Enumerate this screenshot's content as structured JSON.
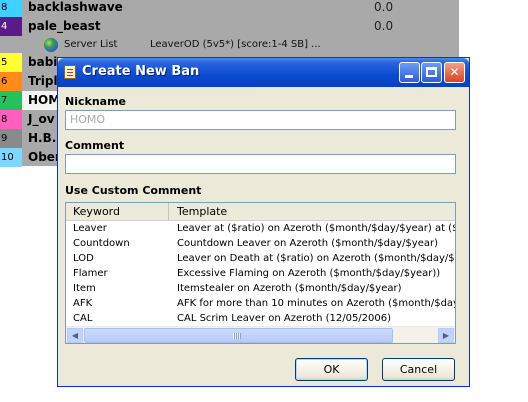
{
  "background": {
    "rows": [
      {
        "num": "8",
        "name": "backlashwave",
        "score": "0.0",
        "color": "#3fd0ff"
      },
      {
        "num": "4",
        "name": "pale_beast",
        "score": "0.0",
        "color": "#5a1a8a"
      },
      {
        "num": "5",
        "name": "babi",
        "score": "",
        "color": "#ffff33"
      },
      {
        "num": "6",
        "name": "Tripl",
        "score": "",
        "color": "#ff8c1a"
      },
      {
        "num": "7",
        "name": "HOM",
        "score": "",
        "color": "#22c45a"
      },
      {
        "num": "8",
        "name": "J_ov",
        "score": "",
        "color": "#ff5fbf"
      },
      {
        "num": "9",
        "name": "H.B.K",
        "score": "",
        "color": "#8a8a8a"
      },
      {
        "num": "10",
        "name": "Ober",
        "score": "",
        "color": "#7fd6ff"
      }
    ],
    "server_row": {
      "icon": "globe-icon",
      "label": "Server List",
      "detail": "LeaverOD (5v5*) [score:1-4 SB] ..."
    }
  },
  "dialog": {
    "title": "Create New Ban",
    "nickname_label": "Nickname",
    "nickname_value": "HOMO",
    "comment_label": "Comment",
    "comment_value": "",
    "custom_label": "Use Custom Comment",
    "columns": {
      "keyword": "Keyword",
      "template": "Template"
    },
    "rows": [
      {
        "keyword": "Leaver",
        "template": "Leaver at ($ratio) on Azeroth ($month/$day/$year) at ($"
      },
      {
        "keyword": "Countdown",
        "template": "Countdown Leaver on Azeroth ($month/$day/$year)"
      },
      {
        "keyword": "LOD",
        "template": "Leaver on Death at ($ratio) on Azeroth ($month/$day/$y"
      },
      {
        "keyword": "Flamer",
        "template": "Excessive Flaming on Azeroth ($month/$day/$year))"
      },
      {
        "keyword": "Item",
        "template": "Itemstealer on Azeroth ($month/$day/$year)"
      },
      {
        "keyword": "AFK",
        "template": "AFK for more than 10 minutes on Azeroth ($month/$day/$"
      },
      {
        "keyword": "CAL",
        "template": "CAL Scrim Leaver on Azeroth (12/05/2006)"
      }
    ],
    "ok_label": "OK",
    "cancel_label": "Cancel"
  }
}
